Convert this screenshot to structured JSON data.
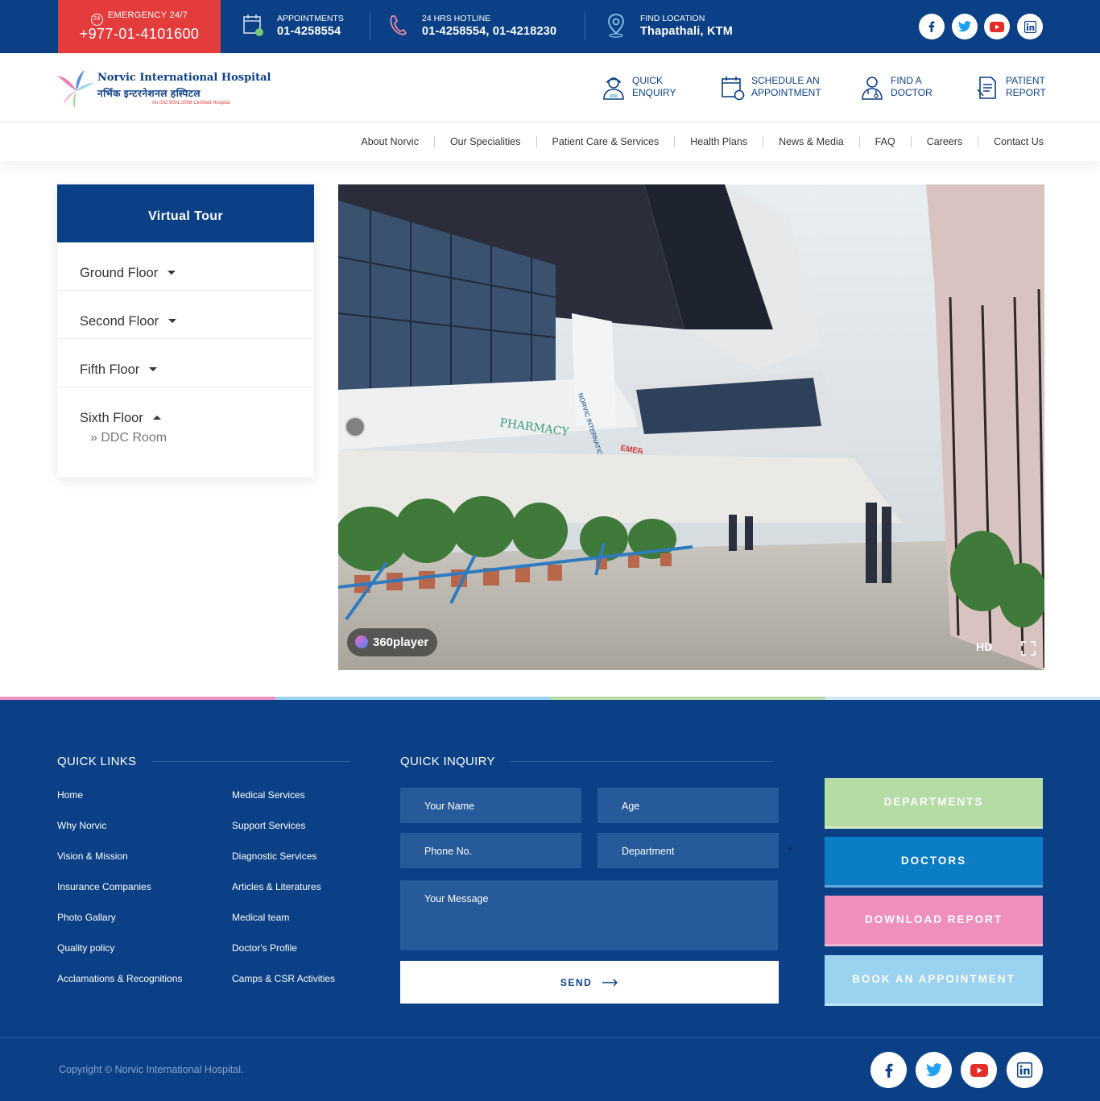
{
  "topbar": {
    "emergency_label": "EMERGENCY 24/7",
    "emergency_number": "+977-01-4101600",
    "emergency_icon_text": "24",
    "appointments_label": "APPOINTMENTS",
    "appointments_number": "01-4258554",
    "hotline_label": "24 HRS HOTLINE",
    "hotline_numbers": "01-4258554, 01-4218230",
    "location_label": "FIND LOCATION",
    "location_value": "Thapathali, KTM"
  },
  "social": [
    "facebook-icon",
    "twitter-icon",
    "youtube-icon",
    "linkedin-icon"
  ],
  "colors": {
    "primary": "#0b4086",
    "emergency": "#e43c3c",
    "departments": "#b5dca4",
    "doctors": "#0b7dc4",
    "download": "#ef8fbd",
    "appointment": "#9bd2ef"
  },
  "logo": {
    "name": "Norvic International Hospital",
    "devanagari": "नर्भिक इन्टरनेशनल हस्पिटल",
    "iso": "An ISO 9001:2008 Certified Hospital"
  },
  "header_links": [
    {
      "line1": "QUICK",
      "line2": "ENQUIRY"
    },
    {
      "line1": "SCHEDULE AN",
      "line2": "APPOINTMENT"
    },
    {
      "line1": "FIND A",
      "line2": "DOCTOR"
    },
    {
      "line1": "PATIENT",
      "line2": "REPORT"
    }
  ],
  "nav": [
    "About Norvic",
    "Our Specialities",
    "Patient Care & Services",
    "Health Plans",
    "News & Media",
    "FAQ",
    "Careers",
    "Contact Us"
  ],
  "sidebar": {
    "title": "Virtual Tour",
    "floors": [
      "Ground Floor",
      "Second Floor",
      "Fifth Floor",
      "Sixth Floor"
    ],
    "sixth_sub": "» DDC Room"
  },
  "tour": {
    "player_brand": "360player",
    "hd": "HD",
    "sign_pharmacy": "PHARMACY",
    "sign_emergency": "EMERGENCY",
    "sign_hospital": "NORVIC INTERNATIONAL HOSPITAL"
  },
  "footer": {
    "quick_links_title": "QUICK LINKS",
    "quick_links_col1": [
      "Home",
      "Why Norvic",
      "Vision & Mission",
      "Insurance Companies",
      "Photo Gallary",
      "Quality policy",
      "Acclamations & Recognitions"
    ],
    "quick_links_col2": [
      "Medical Services",
      "Support Services",
      "Diagnostic Services",
      "Articles & Literatures",
      "Medical team",
      "Doctor's Profile",
      "Camps & CSR Activities"
    ],
    "inquiry_title": "QUICK INQUIRY",
    "fields": {
      "name": "Your Name",
      "age": "Age",
      "phone": "Phone No.",
      "department": "Department",
      "message": "Your Message"
    },
    "send": "SEND",
    "buttons": [
      "DEPARTMENTS",
      "DOCTORS",
      "DOWNLOAD REPORT",
      "BOOK AN APPOINTMENT"
    ],
    "copyright": "Copyright © Norvic International Hospital."
  }
}
